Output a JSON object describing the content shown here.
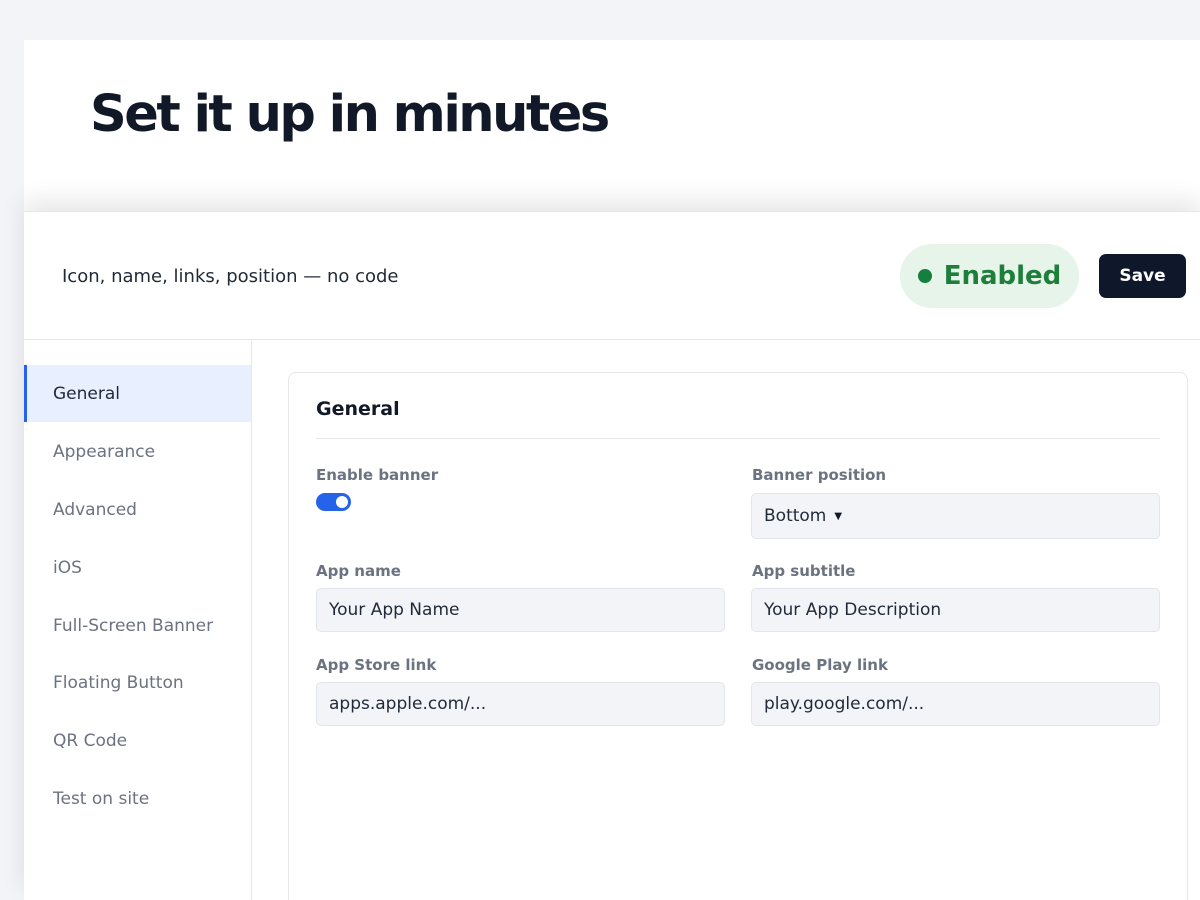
{
  "hero": {
    "title": "Set it up in minutes"
  },
  "header": {
    "subtitle": "Icon, name, links, position — no code",
    "status": {
      "label": "Enabled",
      "color": "#15803d"
    },
    "save_label": "Save"
  },
  "sidebar": {
    "items": [
      {
        "label": "General",
        "active": true
      },
      {
        "label": "Appearance",
        "active": false
      },
      {
        "label": "Advanced",
        "active": false
      },
      {
        "label": "iOS",
        "active": false
      },
      {
        "label": "Full-Screen Banner",
        "active": false
      },
      {
        "label": "Floating Button",
        "active": false
      },
      {
        "label": "QR Code",
        "active": false
      },
      {
        "label": "Test on site",
        "active": false
      }
    ]
  },
  "general": {
    "title": "General",
    "enable_banner": {
      "label": "Enable banner",
      "checked": true
    },
    "banner_position": {
      "label": "Banner position",
      "value": "Bottom"
    },
    "app_name": {
      "label": "App name",
      "value": "Your App Name"
    },
    "app_subtitle": {
      "label": "App subtitle",
      "value": "Your App Description"
    },
    "app_store_link": {
      "label": "App Store link",
      "value": "apps.apple.com/..."
    },
    "google_play_link": {
      "label": "Google Play link",
      "value": "play.google.com/..."
    }
  },
  "colors": {
    "accent": "#2563eb",
    "dark": "#0f172a",
    "success": "#15803d"
  }
}
